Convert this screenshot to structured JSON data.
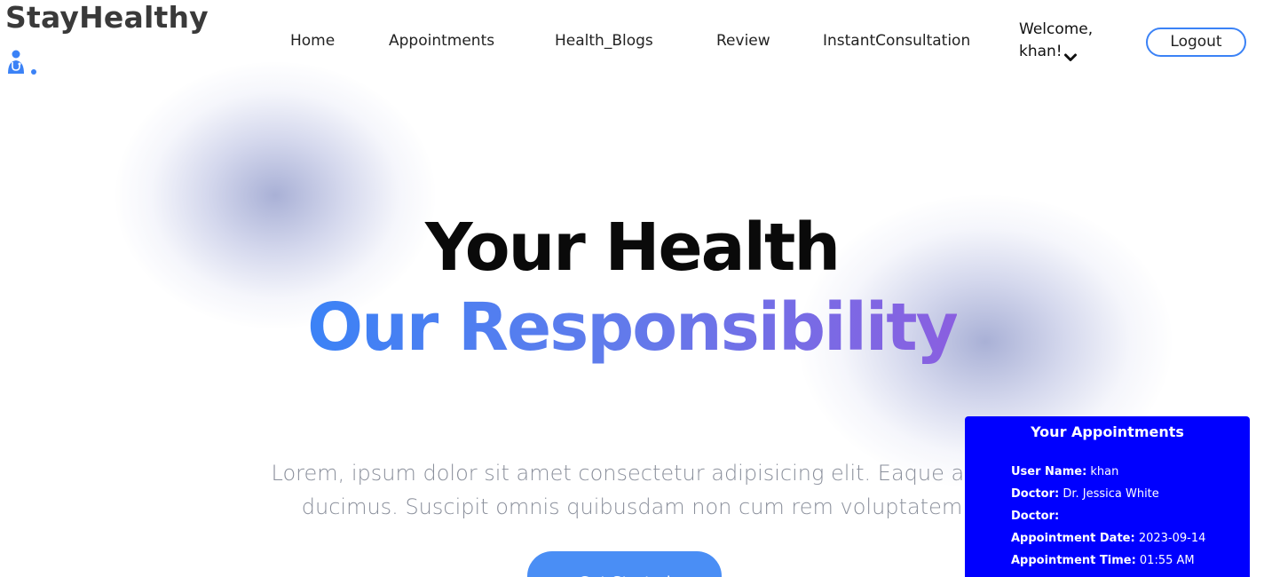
{
  "brand": {
    "name": "StayHealthy",
    "icon": "doctor-icon"
  },
  "nav": {
    "home": "Home",
    "appointments": "Appointments",
    "health_blogs": "Health_Blogs",
    "review": "Review",
    "instant": "InstantConsultation"
  },
  "user": {
    "welcome_line1": "Welcome,",
    "welcome_line2": "khan!",
    "menu_icon": "chevron-down-icon",
    "logout_label": "Logout"
  },
  "hero": {
    "line1": "Your Health",
    "line2": "Our Responsibility",
    "description_line1": "Lorem, ipsum dolor sit amet consectetur adipisicing elit. Eaque at q",
    "description_line2": "ducimus. Suscipit omnis quibusdam non cum rem voluptatem",
    "cta_label": "Get Started"
  },
  "appointments_panel": {
    "title": "Your Appointments",
    "rows": [
      {
        "label": "User Name:",
        "value": " khan"
      },
      {
        "label": "Doctor:",
        "value": " Dr. Jessica White"
      },
      {
        "label": "Doctor:",
        "value": ""
      },
      {
        "label": "Appointment Date:",
        "value": " 2023-09-14"
      },
      {
        "label": "Appointment Time:",
        "value": " 01:55 AM"
      }
    ]
  },
  "colors": {
    "accent": "#3b82f6",
    "panel_bg": "#0000ff",
    "gradient_end": "#8a5fe0"
  }
}
